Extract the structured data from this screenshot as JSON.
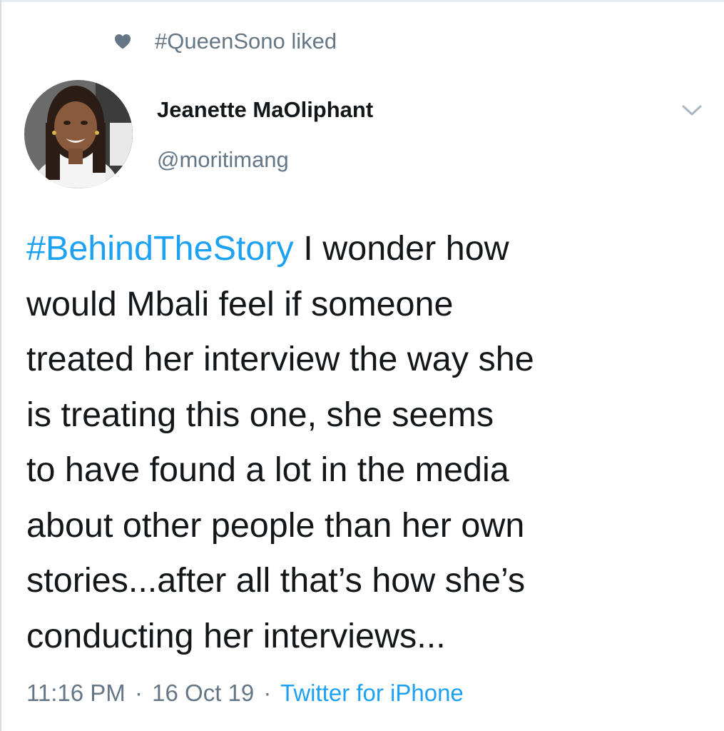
{
  "social_context": {
    "icon": "heart-icon",
    "text": "#QueenSono liked"
  },
  "author": {
    "avatar": "avatar",
    "name": "Jeanette MaOliphant",
    "handle": "@moritimang"
  },
  "menu": {
    "icon": "chevron-down-icon"
  },
  "tweet": {
    "hashtag": "#BehindTheStory",
    "lines": [
      " I wonder how",
      "would Mbali feel if someone",
      "treated her interview the way she",
      "is treating this one, she seems",
      "to have found a lot in the media",
      "about other people than her own",
      "stories...after all that’s how she’s",
      "conducting her interviews..."
    ]
  },
  "meta": {
    "time": "11:16 PM",
    "separator": "·",
    "date": "16 Oct 19",
    "source": "Twitter for iPhone"
  },
  "colors": {
    "link": "#1da1f2",
    "secondary_text": "#657786",
    "primary_text": "#14171a"
  }
}
